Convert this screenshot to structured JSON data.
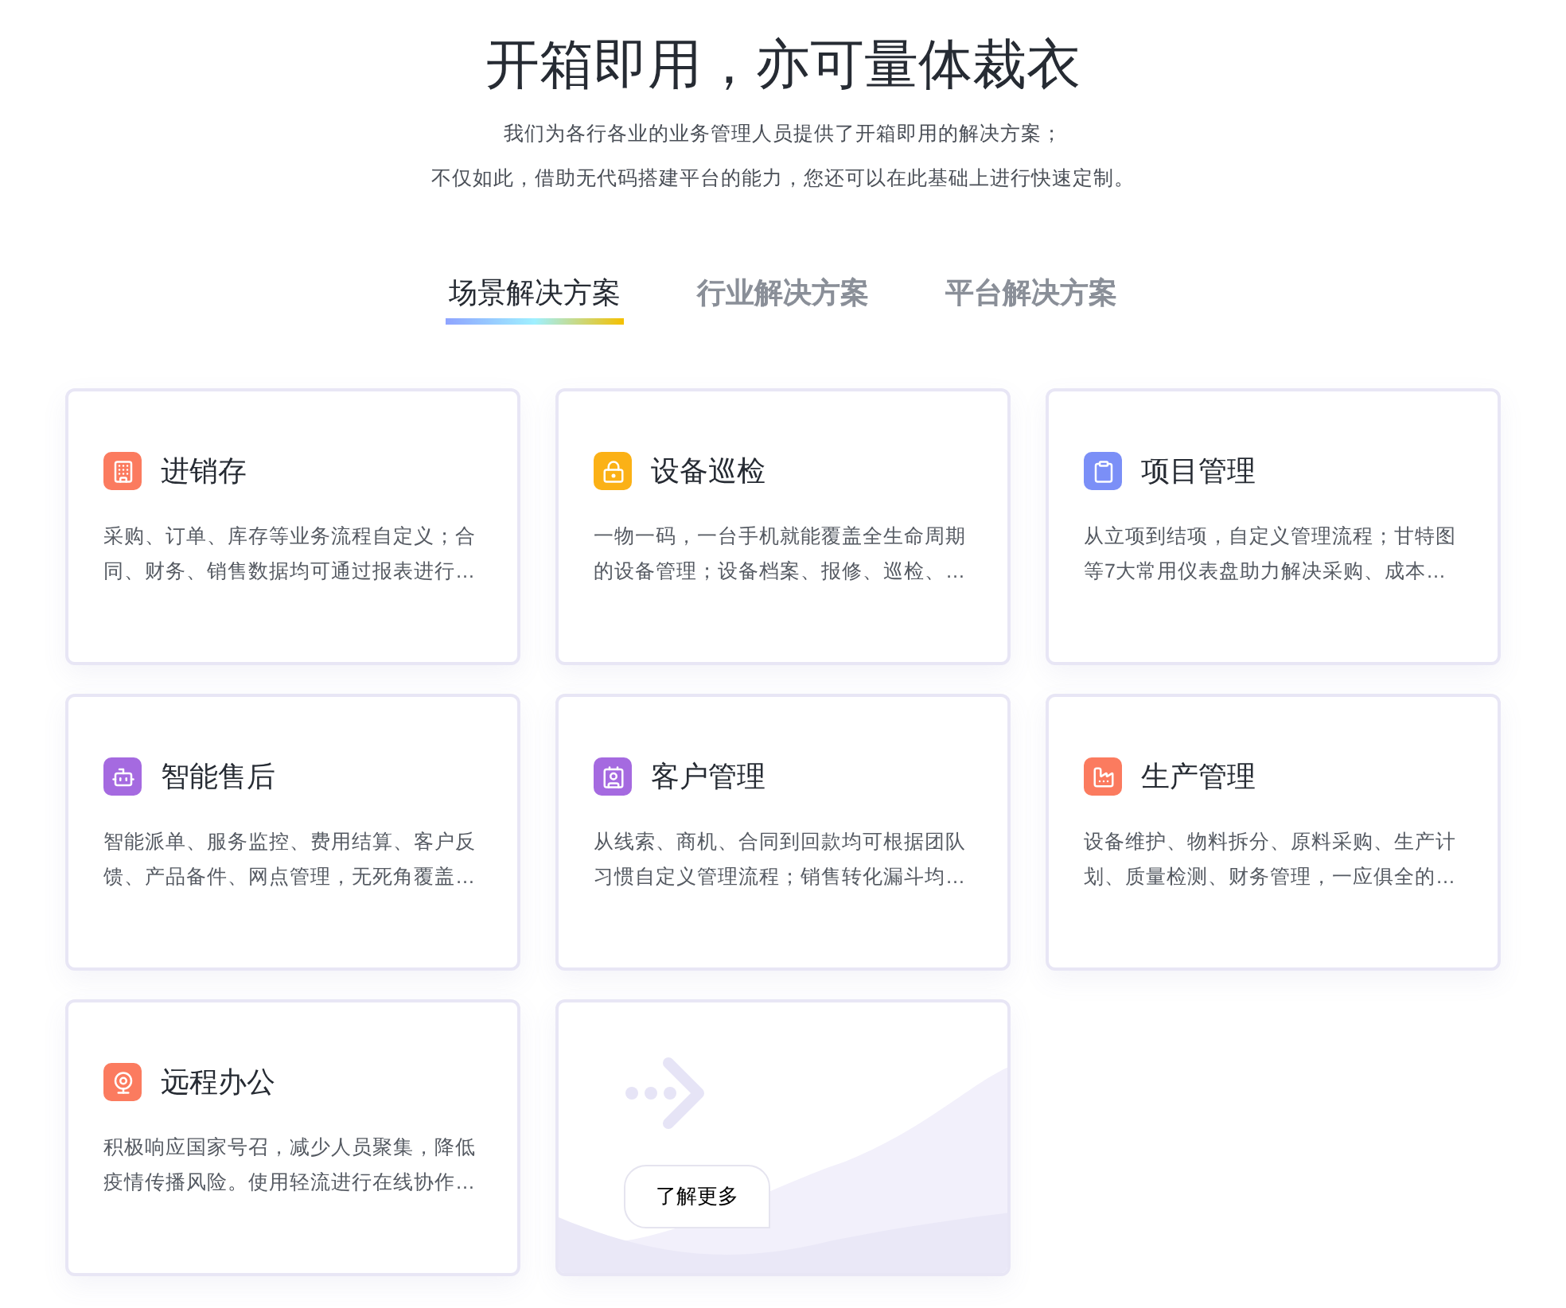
{
  "header": {
    "title": "开箱即用，亦可量体裁衣",
    "subtitle_lines": [
      "我们为各行各业的业务管理人员提供了开箱即用的解决方案；",
      "不仅如此，借助无代码搭建平台的能力，您还可以在此基础上进行快速定制。"
    ]
  },
  "tabs": [
    {
      "label": "场景解决方案",
      "selected": true
    },
    {
      "label": "行业解决方案",
      "selected": false
    },
    {
      "label": "平台解决方案",
      "selected": false
    }
  ],
  "cards": [
    {
      "kind": "building",
      "color": "#fb7b5f",
      "title": "进销存",
      "description": "采购、订单、库存等业务流程自定义；合同、财务、销售数据均可通过报表进行…"
    },
    {
      "kind": "lock",
      "color": "#fbb116",
      "title": "设备巡检",
      "description": "一物一码，一台手机就能覆盖全生命周期的设备管理；设备档案、报修、巡检、…"
    },
    {
      "kind": "clipboard",
      "color": "#7b8ff7",
      "title": "项目管理",
      "description": "从立项到结项，自定义管理流程；甘特图等7大常用仪表盘助力解决采购、成本…"
    },
    {
      "kind": "robot",
      "color": "#a56ae0",
      "title": "智能售后",
      "description": "智能派单、服务监控、费用结算、客户反馈、产品备件、网点管理，无死角覆盖…"
    },
    {
      "kind": "contact",
      "color": "#a56ae0",
      "title": "客户管理",
      "description": "从线索、商机、合同到回款均可根据团队习惯自定义管理流程；销售转化漏斗均…"
    },
    {
      "kind": "factory",
      "color": "#fb7b5f",
      "title": "生产管理",
      "description": "设备维护、物料拆分、原料采购、生产计划、质量检测、财务管理，一应俱全的…"
    },
    {
      "kind": "webcam",
      "color": "#fb7b5f",
      "title": "远程办公",
      "description": "积极响应国家号召，减少人员聚集，降低疫情传播风险。使用轻流进行在线协作…"
    }
  ],
  "more_button": {
    "label": "了解更多"
  }
}
